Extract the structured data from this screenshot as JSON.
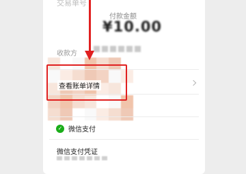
{
  "header": {
    "faded_text": "交易单号"
  },
  "amount": {
    "label": "付款金额",
    "value": "¥10.00"
  },
  "payee": {
    "label": "收款方"
  },
  "detail_row": {
    "label": "查看账单详情"
  },
  "payment_method": {
    "icon": "wechat-pay-icon",
    "label": "微信支付"
  },
  "voucher": {
    "label": "微信支付凭证"
  },
  "annotation": {
    "color": "#e02020"
  }
}
